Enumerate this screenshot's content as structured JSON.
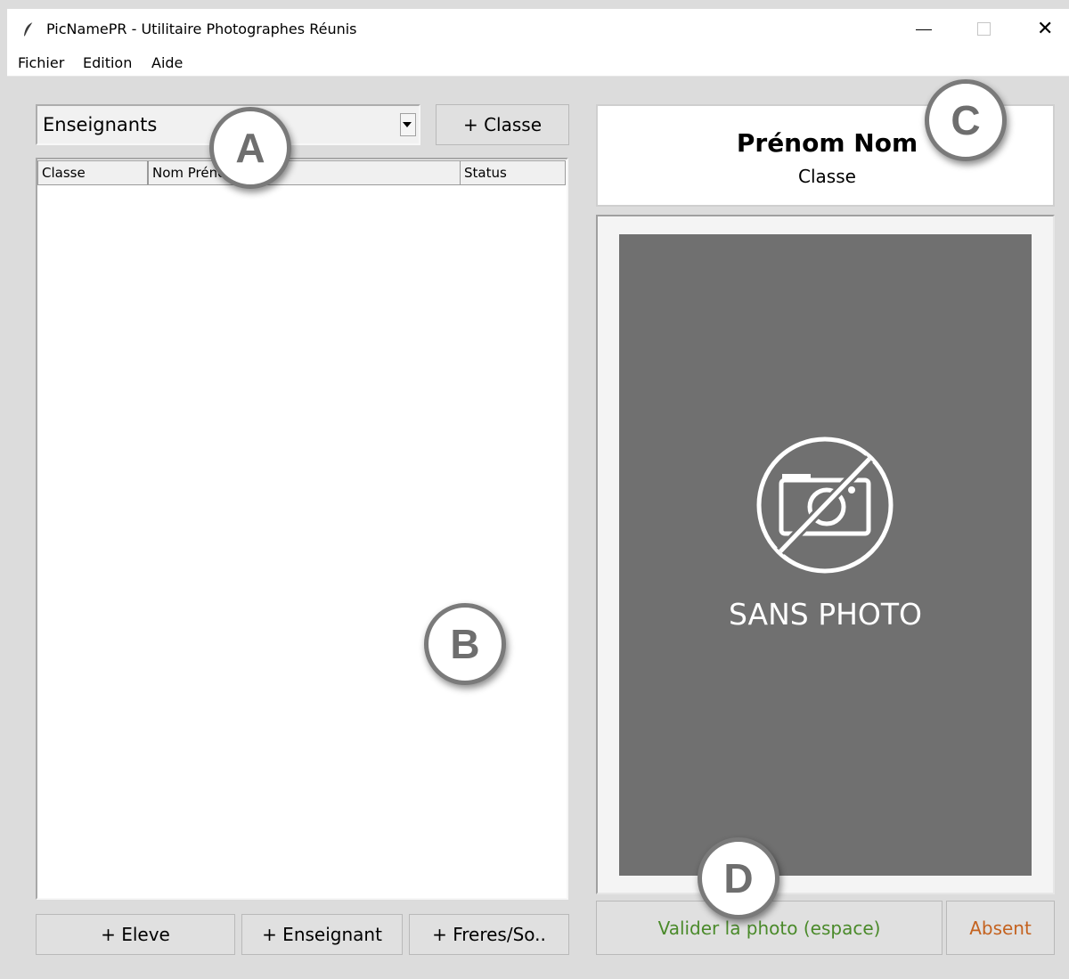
{
  "window": {
    "title": "PicNamePR - Utilitaire Photographes Réunis",
    "close_glyph": "✕"
  },
  "menu": {
    "items": [
      "Fichier",
      "Edition",
      "Aide"
    ]
  },
  "left_panel": {
    "combo_value": "Enseignants",
    "add_class_button": "+ Classe",
    "columns": [
      "Classe",
      "Nom Prénom",
      "Status"
    ],
    "rows": [],
    "buttons": [
      "+ Eleve",
      "+ Enseignant",
      "+ Freres/So.."
    ]
  },
  "right_panel": {
    "name": "Prénom Nom",
    "classe": "Classe",
    "photo_placeholder": "SANS PHOTO",
    "photo_placeholder_icon": "no-camera-icon",
    "validate_button": "Valider la photo (espace)",
    "absent_button": "Absent",
    "validate_color": "#4a8a2a",
    "absent_color": "#c4621f"
  },
  "markers": [
    "A",
    "B",
    "C",
    "D"
  ]
}
